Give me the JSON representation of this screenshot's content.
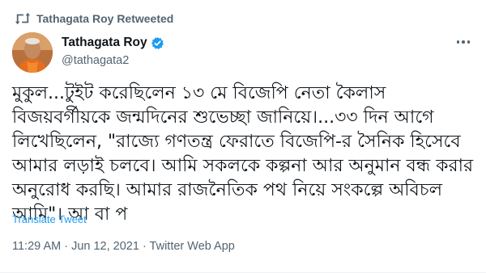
{
  "retweet": {
    "label": "Tathagata Roy Retweeted",
    "icon": "retweet-icon"
  },
  "author": {
    "display_name": "Tathagata Roy",
    "handle": "@tathagata2",
    "verified": true,
    "verified_color": "#1d9bf0"
  },
  "tweet": {
    "text": "মুকুল...টুইট করেছিলেন ১৩ মে বিজেপি নেতা কৈলাস বিজয়বর্গীয়কে জন্মদিনের শুভেচ্ছা জানিয়ে।...৩৩ দিন আগে লিখেছিলেন, \"রাজ্যে গণতন্ত্র ফেরাতে বিজেপি-র সৈনিক হিসেবে আমার লড়াই চলবে।  আমি সকলকে কল্পনা আর অনুমান বন্ধ করার অনুরোধ করছি। আমার রাজনৈতিক পথ নিয়ে সংকল্পে অবিচল আমি\"। আ বা প",
    "translate_label": "Translate Tweet",
    "meta": "11:29 AM · Jun 12, 2021 · Twitter Web App"
  },
  "colors": {
    "link": "#1d9bf0",
    "secondary_text": "#536471",
    "primary_text": "#0f1419"
  }
}
